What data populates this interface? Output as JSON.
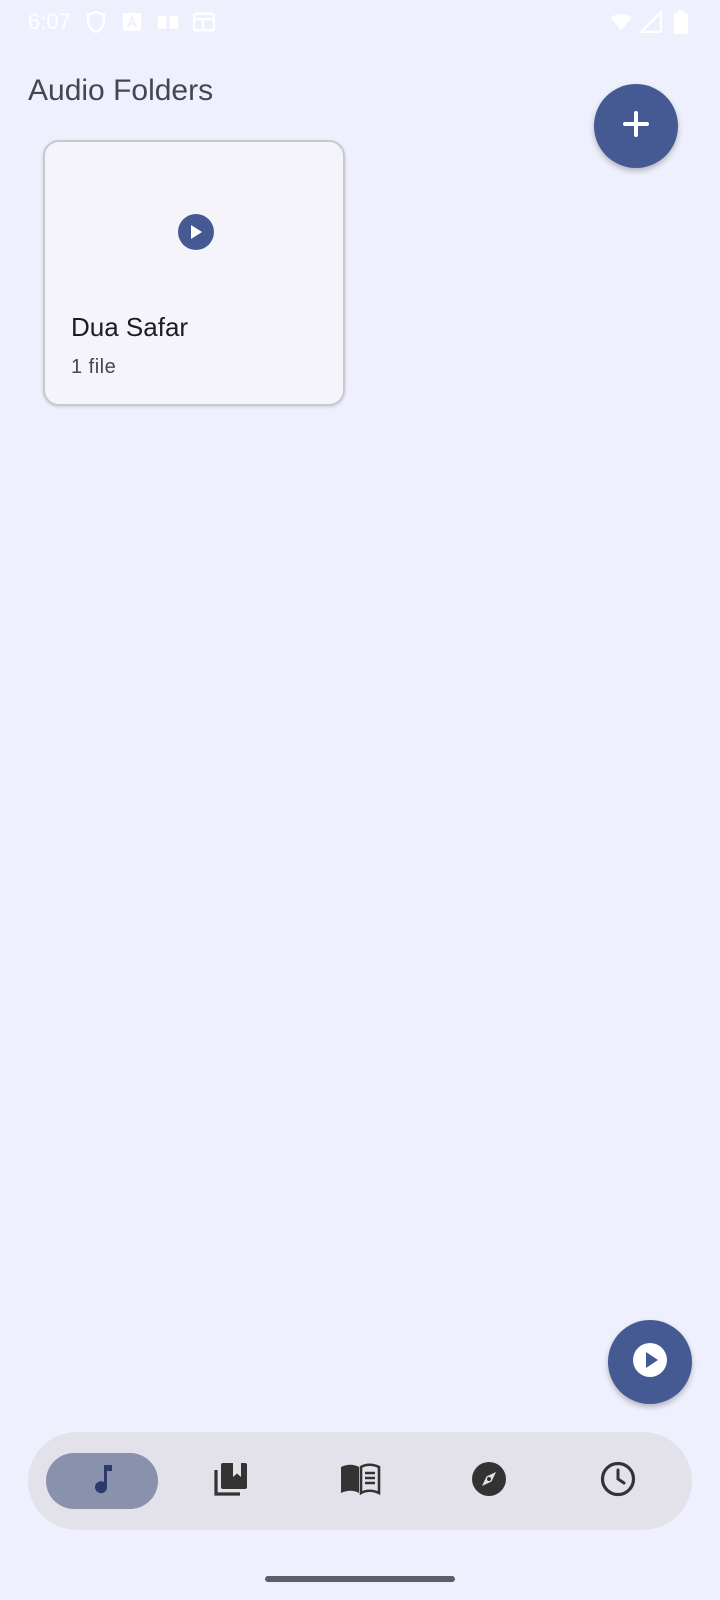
{
  "status_bar": {
    "time": "6:07",
    "icons_left": [
      "shield-icon",
      "font-a-icon",
      "book-open-icon",
      "calendar-icon"
    ],
    "icons_right": [
      "wifi-icon",
      "signal-icon",
      "battery-icon"
    ]
  },
  "header": {
    "title": "Audio Folders"
  },
  "fab": {
    "add_icon": "plus-icon",
    "player_icon": "play-icon"
  },
  "folders": [
    {
      "name": "Dua Safar",
      "count": "1 file",
      "icon": "play-icon"
    }
  ],
  "bottom_nav": {
    "items": [
      {
        "icon": "music-note-icon",
        "active": true
      },
      {
        "icon": "bookmarks-icon",
        "active": false
      },
      {
        "icon": "book-icon",
        "active": false
      },
      {
        "icon": "compass-icon",
        "active": false
      },
      {
        "icon": "clock-icon",
        "active": false
      }
    ]
  },
  "colors": {
    "background": "#eff0fd",
    "primary": "#455a93",
    "card": "#f6f4fb",
    "nav_background": "#e3e2ea",
    "nav_active": "#8a91ad"
  }
}
